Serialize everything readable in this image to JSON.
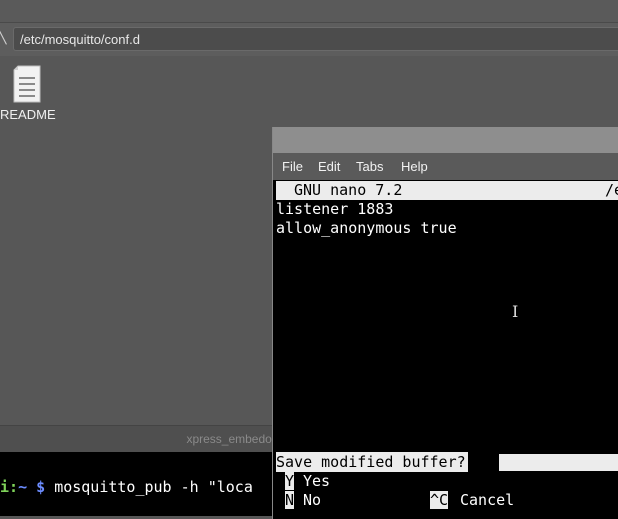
{
  "file_manager": {
    "path": "/etc/mosquitto/conf.d",
    "back_icon": "chevron-left-icon",
    "files": [
      {
        "name": "README",
        "icon": "text-file-icon"
      }
    ],
    "status_text": "xpress_embedo@r"
  },
  "terminal": {
    "host_fragment": "i:",
    "path": "~",
    "prompt_symbol": "$",
    "command": "mosquitto_pub -h \"loca"
  },
  "nano_window": {
    "menu": [
      "File",
      "Edit",
      "Tabs",
      "Help"
    ],
    "header_title": "GNU nano 7.2",
    "header_right": "/e",
    "lines": [
      "listener 1883",
      "allow_anonymous true"
    ],
    "prompt": "Save modified buffer?",
    "options": [
      {
        "key": "Y",
        "label": "Yes"
      },
      {
        "key": "N",
        "label": "No"
      },
      {
        "key": "^C",
        "label": "Cancel"
      }
    ]
  }
}
